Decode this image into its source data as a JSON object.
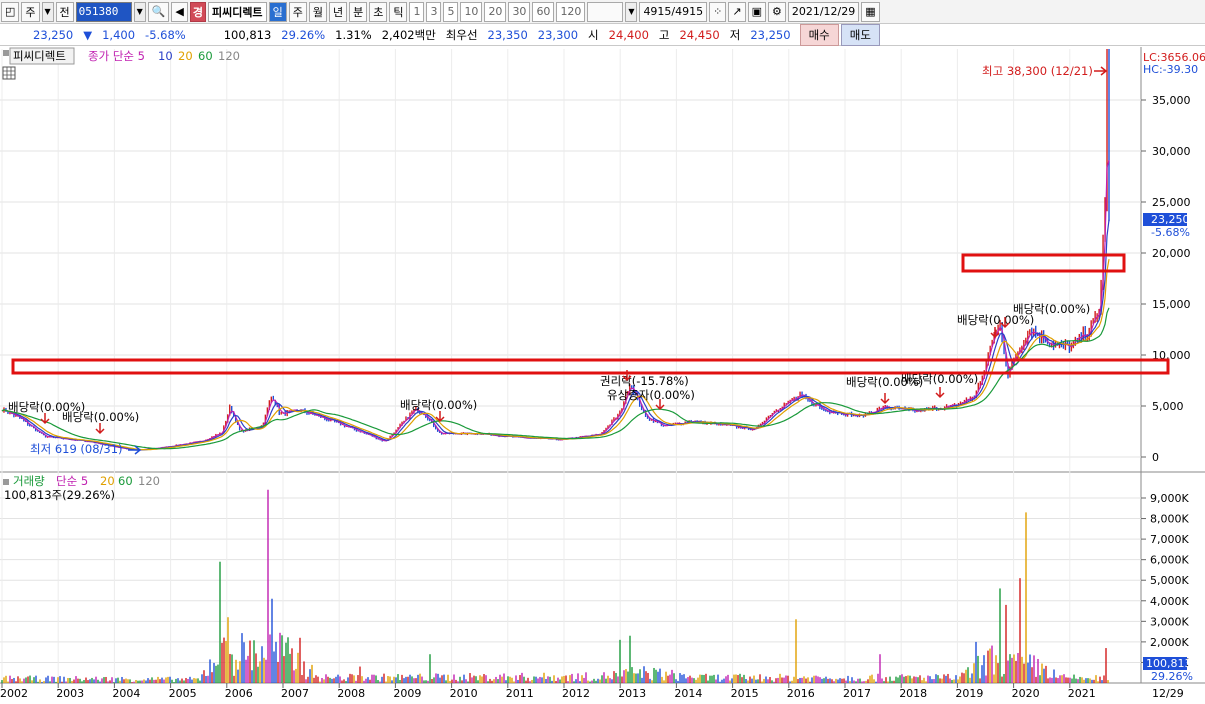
{
  "toolbar": {
    "market_label": "주",
    "period_label": "전",
    "code": "051380",
    "gyeong_label": "경",
    "stock_name": "피씨디렉트",
    "periods": [
      "일",
      "주",
      "월",
      "년",
      "분",
      "초",
      "틱"
    ],
    "selected_period": "일",
    "intervals": [
      "1",
      "3",
      "5",
      "10",
      "20",
      "30",
      "60",
      "120"
    ],
    "count_display": "4915/4915",
    "date": "2021/12/29"
  },
  "quote": {
    "price": "23,250",
    "change": "1,400",
    "change_pct": "-5.68%",
    "volume": "100,813",
    "turnover_pct": "29.26%",
    "ratio": "1.31%",
    "amount": "2,402백만",
    "best_label": "최우선",
    "ask": "23,350",
    "bid": "23,300",
    "open_label": "시",
    "open": "24,400",
    "high_label": "고",
    "high": "24,450",
    "low_label": "저",
    "low": "23,250",
    "buy_label": "매수",
    "sell_label": "매도"
  },
  "price_panel": {
    "legend_name": "피씨디렉트",
    "legend_ma": "종가 단순 5",
    "ma_periods": [
      "10",
      "20",
      "60",
      "120"
    ],
    "lc_label": "LC:3656.06",
    "hc_label": "HC:-39.30",
    "current_price_tag": "23,250",
    "current_pct_tag": "-5.68%",
    "high_annotation": "최고 38,300 (12/21)",
    "low_annotation": "최저 619 (08/31)",
    "y_ticks": [
      "35,000",
      "30,000",
      "25,000",
      "20,000",
      "15,000",
      "10,000",
      "5,000",
      "0"
    ],
    "event_labels": [
      "배당락(0.00%)",
      "배당락(0.00%)",
      "배당락(0.00%)",
      "권리락(-15.78%)",
      "유상증자(0.00%)",
      "배당락(0.00%)",
      "배당락(0.00%)",
      "배당락(0.00%)",
      "배당락(0.00%)"
    ]
  },
  "volume_panel": {
    "legend_name": "거래량",
    "legend_ma": "단순 5",
    "ma_periods": [
      "20",
      "60",
      "120"
    ],
    "value_label": "100,813주(29.26%)",
    "current_tag": "100,813",
    "current_pct_tag": "29.26%",
    "y_ticks": [
      "9,000K",
      "8,000K",
      "7,000K",
      "6,000K",
      "5,000K",
      "4,000K",
      "3,000K",
      "2,000K",
      "1,000K"
    ]
  },
  "x_axis": {
    "years": [
      "2002",
      "2003",
      "2004",
      "2005",
      "2006",
      "2007",
      "2008",
      "2009",
      "2010",
      "2011",
      "2012",
      "2013",
      "2014",
      "2015",
      "2016",
      "2017",
      "2018",
      "2019",
      "2020",
      "2021"
    ],
    "right_label": "12/29"
  },
  "colors": {
    "up": "#d21c1c",
    "down": "#1e4fd8",
    "ma5": "#c01fb0",
    "ma10": "#2a40c8",
    "ma20": "#e0a000",
    "ma60": "#1a9a3a",
    "ma120": "#888888",
    "highlight_box": "#e01010"
  }
}
